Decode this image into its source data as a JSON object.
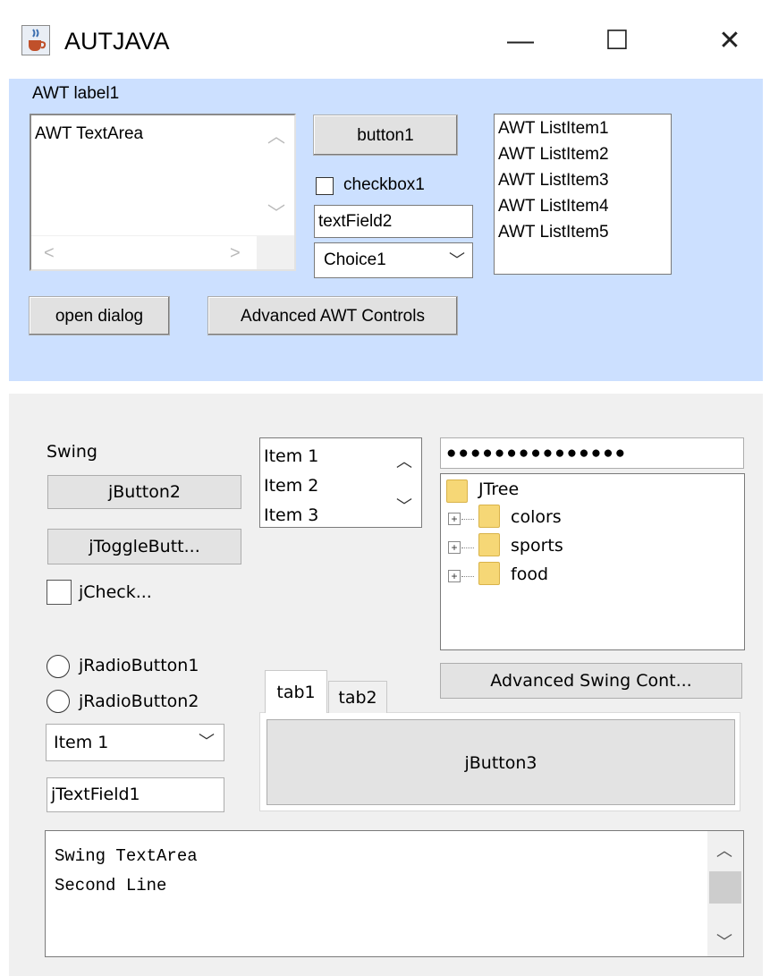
{
  "window": {
    "title": "AUTJAVA",
    "minimize_glyph": "—",
    "maximize_glyph": "☐",
    "close_glyph": "✕"
  },
  "awt": {
    "label": "AWT label1",
    "textarea": "AWT TextArea",
    "button1": "button1",
    "checkbox1": "checkbox1",
    "textfield2": "textField2",
    "choice": "Choice1",
    "list_items": [
      "AWT ListItem1",
      "AWT ListItem2",
      "AWT ListItem3",
      "AWT ListItem4",
      "AWT ListItem5"
    ],
    "open_dialog": "open dialog",
    "advanced_button": "Advanced AWT Controls",
    "panel_color": "#cce0ff"
  },
  "swing": {
    "label": "Swing",
    "jbutton2": "jButton2",
    "jtoggle": "jToggleButt...",
    "jcheck": "jCheck...",
    "radio1": "jRadioButton1",
    "radio2": "jRadioButton2",
    "combo": "Item 1",
    "jtextfield1": "jTextField1",
    "list_items": [
      "Item 1",
      "Item 2",
      "Item 3"
    ],
    "password": "●●●●●●●●●●●●●●●",
    "tree": {
      "root": "JTree",
      "children": [
        "colors",
        "sports",
        "food"
      ]
    },
    "advanced_button": "Advanced Swing Cont...",
    "tabs": [
      "tab1",
      "tab2"
    ],
    "jbutton3": "jButton3",
    "textarea_lines": "Swing TextArea\nSecond Line"
  }
}
